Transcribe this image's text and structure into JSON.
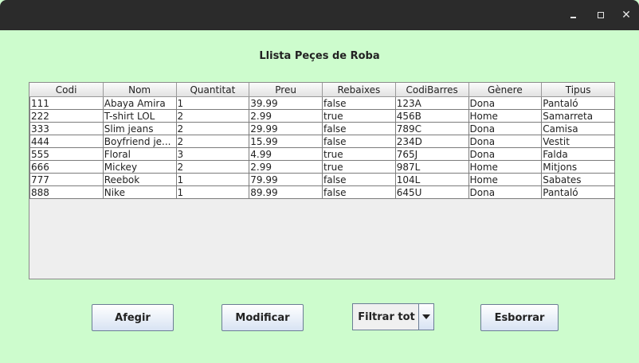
{
  "window": {
    "controls": [
      "minimize-icon",
      "maximize-icon",
      "close-icon"
    ],
    "close_glyph": "✕"
  },
  "heading": "Llista Peçes de Roba",
  "table": {
    "columns": [
      "Codi",
      "Nom",
      "Quantitat",
      "Preu",
      "Rebaixes",
      "CodiBarres",
      "Gènere",
      "Tipus"
    ],
    "rows": [
      [
        "111",
        "Abaya Amira",
        "1",
        "39.99",
        "false",
        "123A",
        "Dona",
        "Pantaló"
      ],
      [
        "222",
        "T-shirt LOL",
        "2",
        "2.99",
        "true",
        "456B",
        "Home",
        "Samarreta"
      ],
      [
        "333",
        "Slim jeans",
        "2",
        "29.99",
        "false",
        "789C",
        "Dona",
        "Camisa"
      ],
      [
        "444",
        "Boyfriend je...",
        "2",
        "15.99",
        "false",
        "234D",
        "Dona",
        "Vestit"
      ],
      [
        "555",
        "Floral",
        "3",
        "4.99",
        "true",
        "765J",
        "Dona",
        "Falda"
      ],
      [
        "666",
        "Mickey",
        "2",
        "2.99",
        "true",
        "987L",
        "Home",
        "Mitjons"
      ],
      [
        "777",
        "Reebok",
        "1",
        "79.99",
        "false",
        "104L",
        "Home",
        "Sabates"
      ],
      [
        "888",
        "Nike",
        "1",
        "89.99",
        "false",
        "645U",
        "Dona",
        "Pantaló"
      ]
    ]
  },
  "buttons": {
    "add": "Afegir",
    "modify": "Modificar",
    "delete": "Esborrar"
  },
  "filter": {
    "selected": "Filtrar tot"
  },
  "colors": {
    "background": "#cdfccd",
    "titlebar": "#2b2b2b"
  }
}
